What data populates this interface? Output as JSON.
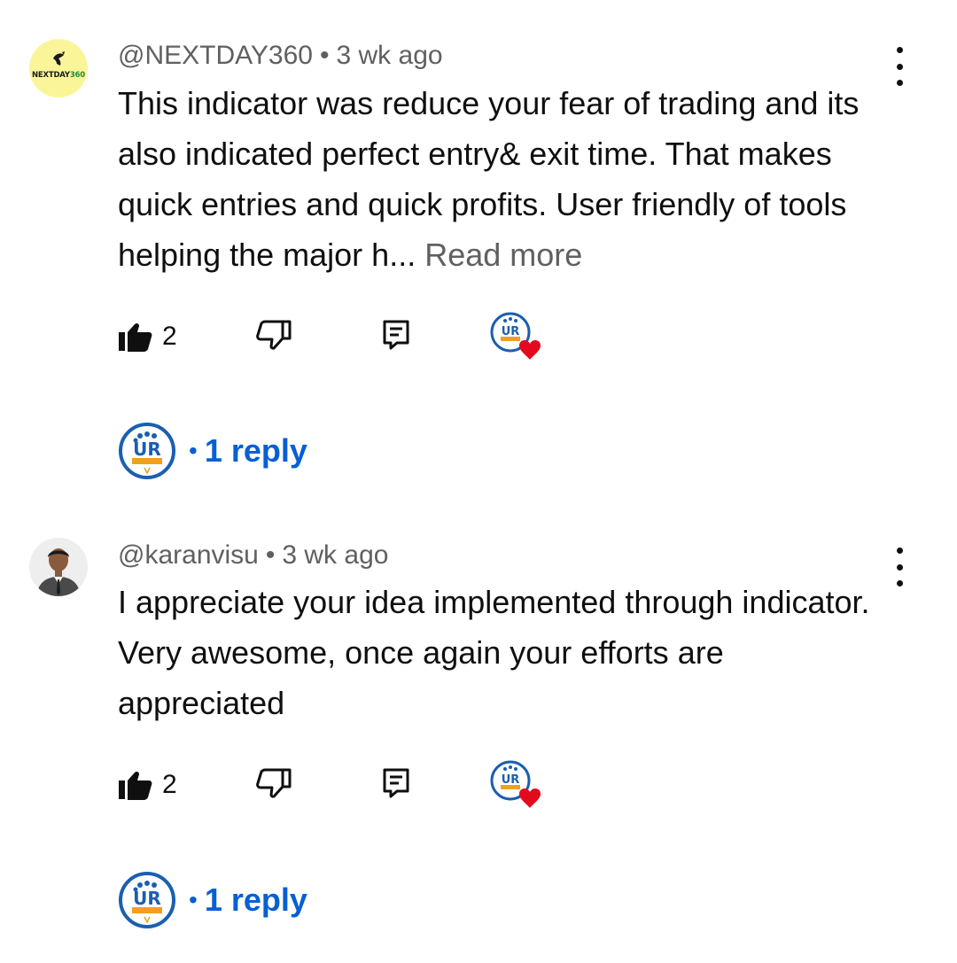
{
  "comments": [
    {
      "handle": "@NEXTDAY360",
      "time": "3 wk ago",
      "avatar_text_a": "NEXTDAY",
      "avatar_text_b": "360",
      "text": "This indicator was reduce your fear of trading and its also indicated perfect entry& exit time. That makes quick entries and quick profits. User friendly of tools helping the major h...",
      "read_more": "Read more",
      "likes": "2",
      "replies": "1 reply"
    },
    {
      "handle": "@karanvisu",
      "time": "3 wk ago",
      "text": "I appreciate your idea implemented through indicator. Very awesome, once again your efforts are appreciated",
      "likes": "2",
      "replies": "1 reply"
    }
  ],
  "separator": "•",
  "colors": {
    "link_blue": "#065fd4",
    "meta_gray": "#606060",
    "heart_red": "#e5091e",
    "avatar_yellow": "#fbf59a"
  },
  "icons": [
    "like-icon",
    "dislike-icon",
    "reply-icon",
    "creator-heart-icon",
    "more-vert-icon"
  ]
}
